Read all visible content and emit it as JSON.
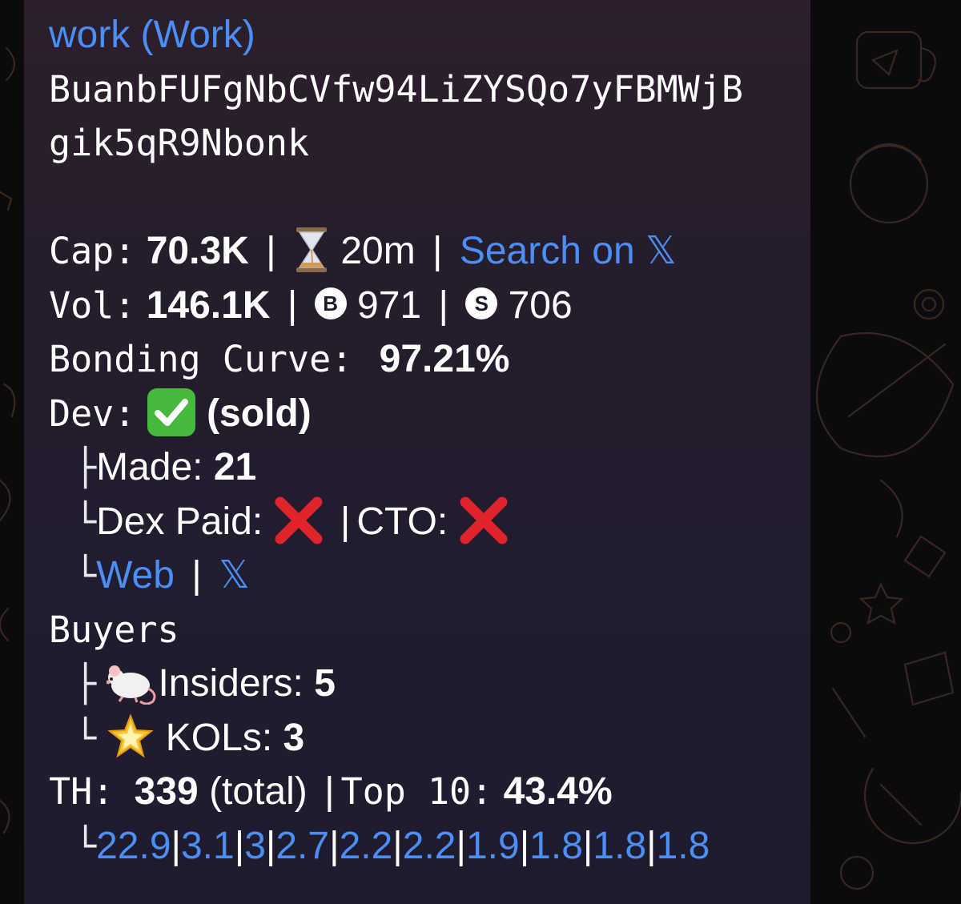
{
  "message": {
    "title": "work (Work)",
    "address_line1": "BuanbFUFgNbCVfw94LiZYSQo7yFBMWjB",
    "address_line2": "gik5qR9Nbonk",
    "cap": {
      "label": "Cap:",
      "value": "70.3K",
      "age": "20m",
      "search_link": "Search on",
      "x_glyph": "𝕏"
    },
    "vol": {
      "label": "Vol:",
      "value": "146.1K",
      "buys_icon": "B",
      "buys": "971",
      "sells_icon": "S",
      "sells": "706"
    },
    "bonding": {
      "label": "Bonding Curve:",
      "value": "97.21%"
    },
    "dev": {
      "label": "Dev:",
      "status": "(sold)",
      "made_label": "Made:",
      "made_value": "21",
      "dex_paid_label": "Dex Paid:",
      "cto_label": "CTO:",
      "web_link": "Web",
      "x_glyph": "𝕏"
    },
    "buyers": {
      "label": "Buyers",
      "insiders_label": "Insiders:",
      "insiders_value": "5",
      "kols_label": "KOLs:",
      "kols_value": "3"
    },
    "holders": {
      "label": "TH:",
      "total_value": "339",
      "total_label": "(total)",
      "top_label": "Top 10:",
      "top_value": "43.4%",
      "top_list": [
        "22.9",
        "3.1",
        "3",
        "2.7",
        "2.2",
        "2.2",
        "1.9",
        "1.8",
        "1.8",
        "1.8"
      ]
    }
  },
  "colors": {
    "link": "#4a8ef6",
    "bubble": "#241d2d",
    "background": "#0b0b0d"
  },
  "icons": [
    "hourglass-icon",
    "buys-circle-icon",
    "sells-circle-icon",
    "check-icon",
    "cross-icon",
    "mouse-icon",
    "star-icon",
    "x-logo-icon"
  ]
}
